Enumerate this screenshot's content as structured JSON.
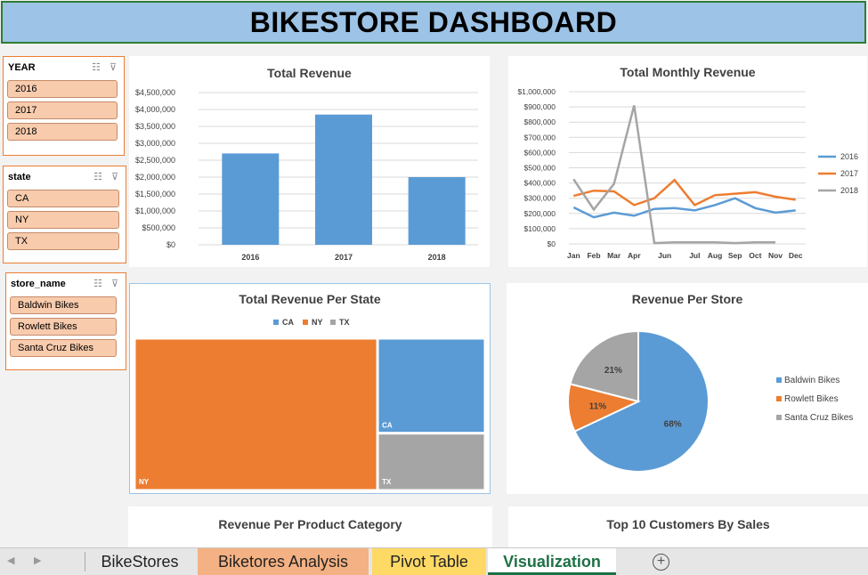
{
  "banner": {
    "title": "BIKESTORE DASHBOARD"
  },
  "slicers": {
    "year": {
      "header": "YEAR",
      "items": [
        "2016",
        "2017",
        "2018"
      ]
    },
    "state": {
      "header": "state",
      "items": [
        "CA",
        "NY",
        "TX"
      ]
    },
    "store": {
      "header": "store_name",
      "items": [
        "Baldwin Bikes",
        "Rowlett Bikes",
        "Santa Cruz Bikes"
      ]
    }
  },
  "charts": {
    "total_revenue": {
      "title": "Total Revenue"
    },
    "monthly": {
      "title": "Total Monthly Revenue"
    },
    "per_state": {
      "title": "Total Revenue Per State"
    },
    "per_store": {
      "title": "Revenue Per Store"
    },
    "per_category": {
      "title": "Revenue Per Product Category"
    },
    "top_customers": {
      "title": "Top 10 Customers By Sales"
    }
  },
  "colors": {
    "blue": "#5b9bd5",
    "orange": "#ed7d31",
    "gray": "#a5a5a5",
    "banner": "#9dc3e6",
    "slicer_fill": "#f8cbad"
  },
  "chart_data": [
    {
      "type": "bar",
      "title": "Total Revenue",
      "categories": [
        "2016",
        "2017",
        "2018"
      ],
      "values": [
        2700000,
        3850000,
        2000000
      ],
      "ylim": [
        0,
        4500000
      ],
      "yticks": [
        "$4,500,000",
        "$4,000,000",
        "$3,500,000",
        "$3,000,000",
        "$2,500,000",
        "$2,000,000",
        "$1,500,000",
        "$1,000,000",
        "$500,000",
        "$0"
      ]
    },
    {
      "type": "line",
      "title": "Total Monthly Revenue",
      "categories": [
        "Jan",
        "Feb",
        "Mar",
        "Apr",
        "Jun",
        "Jul",
        "Aug",
        "Sep",
        "Oct",
        "Nov",
        "Dec"
      ],
      "ylim": [
        0,
        1000000
      ],
      "yticks": [
        "$1,000,000",
        "$900,000",
        "$800,000",
        "$700,000",
        "$600,000",
        "$500,000",
        "$400,000",
        "$300,000",
        "$200,000",
        "$100,000",
        "$0"
      ],
      "legend": "right",
      "series": [
        {
          "name": "2016",
          "values": [
            240000,
            175000,
            205000,
            185000,
            230000,
            235000,
            220000,
            255000,
            300000,
            235000,
            205000,
            220000
          ]
        },
        {
          "name": "2017",
          "values": [
            315000,
            350000,
            345000,
            255000,
            300000,
            420000,
            255000,
            320000,
            330000,
            340000,
            310000,
            290000
          ]
        },
        {
          "name": "2018",
          "values": [
            425000,
            225000,
            395000,
            910000,
            5000,
            10000,
            10000,
            10000,
            5000,
            10000,
            10000,
            null
          ]
        }
      ]
    },
    {
      "type": "treemap",
      "title": "Total Revenue Per State",
      "legend": "top",
      "categories": [
        "CA",
        "NY",
        "TX"
      ],
      "values": [
        1605823,
        5826242,
        962600
      ]
    },
    {
      "type": "pie",
      "title": "Revenue Per Store",
      "legend": "right",
      "categories": [
        "Baldwin Bikes",
        "Rowlett Bikes",
        "Santa Cruz Bikes"
      ],
      "values": [
        68,
        11,
        21
      ],
      "labels": [
        "68%",
        "11%",
        "21%"
      ]
    }
  ],
  "tabs": [
    {
      "label": "BikeStores"
    },
    {
      "label": "Biketores Analysis"
    },
    {
      "label": "Pivot Table"
    },
    {
      "label": "Visualization"
    }
  ]
}
